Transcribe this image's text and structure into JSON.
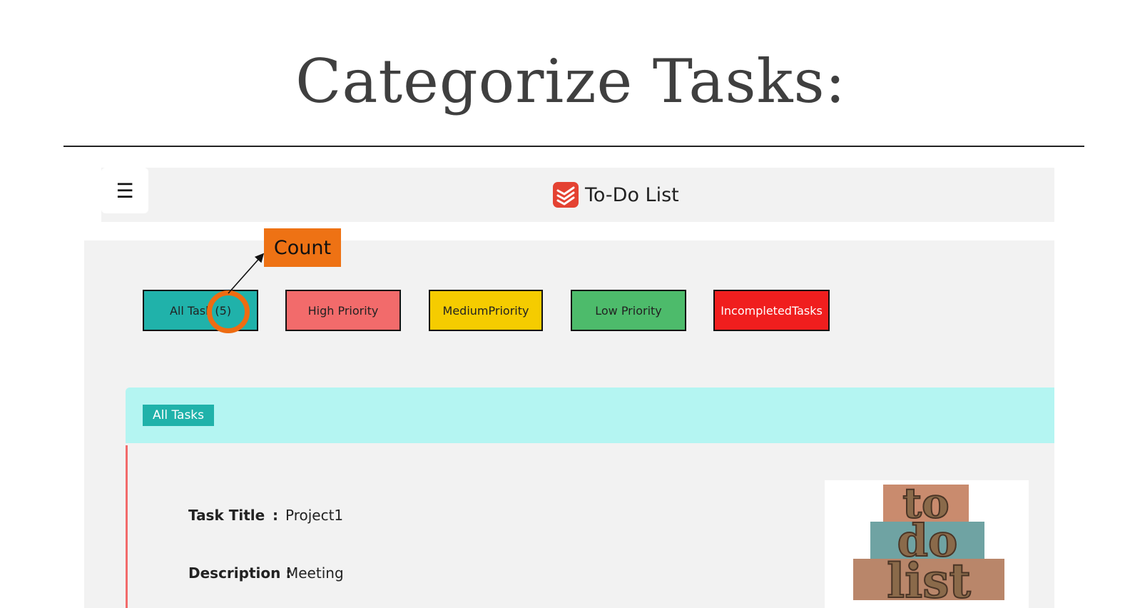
{
  "slide": {
    "title": "Categorize Tasks:"
  },
  "header": {
    "menu_icon": "☰",
    "app_title": "To-Do List",
    "logo_icon": "todoist-logo-icon",
    "logo_color": "#e44232"
  },
  "filters": [
    {
      "label": "All Task",
      "count": "(5)",
      "color": "#20b2aa"
    },
    {
      "label": "High Priority",
      "color": "#f26b6b"
    },
    {
      "label": "MediumPriority",
      "color": "#f5cc00"
    },
    {
      "label": "Low Priority",
      "color": "#4dbb6b"
    },
    {
      "label": "IncompletedTasks",
      "color": "#f01e1e"
    }
  ],
  "annotation": {
    "label": "Count",
    "color": "#ee7214"
  },
  "section": {
    "label": "All Tasks"
  },
  "task": {
    "title_label": "Task Title",
    "title_colon": ":",
    "title_value": "Project1",
    "description_label": "Description :",
    "description_value": "Meeting",
    "image_words": [
      "to",
      "do",
      "list"
    ]
  }
}
